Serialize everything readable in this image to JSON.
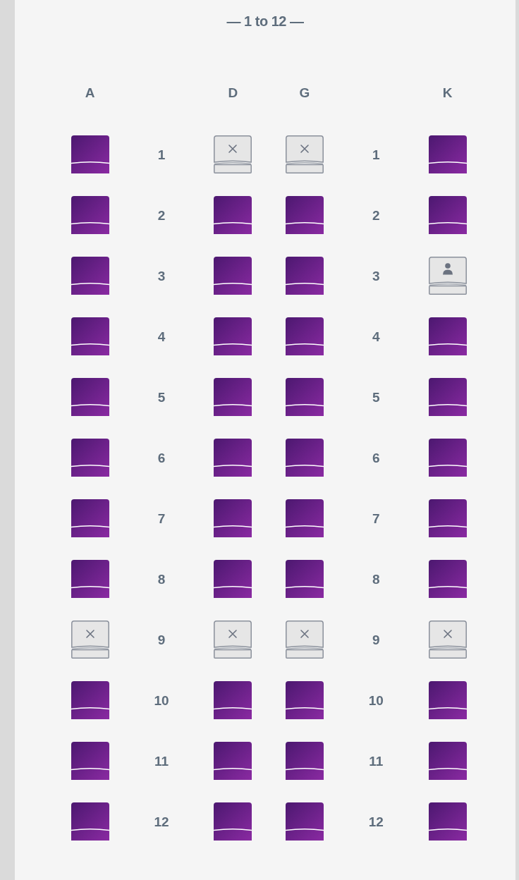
{
  "title": "— 1 to 12 —",
  "columns": [
    {
      "kind": "seat",
      "label": "A"
    },
    {
      "kind": "aisle"
    },
    {
      "kind": "seat",
      "label": "D"
    },
    {
      "kind": "seat",
      "label": "G"
    },
    {
      "kind": "aisle"
    },
    {
      "kind": "seat",
      "label": "K"
    }
  ],
  "rows": [
    {
      "cells": [
        {
          "kind": "open_seat"
        },
        {
          "kind": "row_number",
          "text": "1"
        },
        {
          "kind": "blocked_seat"
        },
        {
          "kind": "blocked_seat"
        },
        {
          "kind": "row_number",
          "text": "1"
        },
        {
          "kind": "open_seat"
        }
      ]
    },
    {
      "cells": [
        {
          "kind": "open_seat"
        },
        {
          "kind": "row_number",
          "text": "2"
        },
        {
          "kind": "open_seat"
        },
        {
          "kind": "open_seat"
        },
        {
          "kind": "row_number",
          "text": "2"
        },
        {
          "kind": "open_seat"
        }
      ]
    },
    {
      "cells": [
        {
          "kind": "open_seat"
        },
        {
          "kind": "row_number",
          "text": "3"
        },
        {
          "kind": "open_seat"
        },
        {
          "kind": "open_seat"
        },
        {
          "kind": "row_number",
          "text": "3"
        },
        {
          "kind": "taken_seat"
        }
      ]
    },
    {
      "cells": [
        {
          "kind": "open_seat"
        },
        {
          "kind": "row_number",
          "text": "4"
        },
        {
          "kind": "open_seat"
        },
        {
          "kind": "open_seat"
        },
        {
          "kind": "row_number",
          "text": "4"
        },
        {
          "kind": "open_seat"
        }
      ]
    },
    {
      "cells": [
        {
          "kind": "open_seat"
        },
        {
          "kind": "row_number",
          "text": "5"
        },
        {
          "kind": "open_seat"
        },
        {
          "kind": "open_seat"
        },
        {
          "kind": "row_number",
          "text": "5"
        },
        {
          "kind": "open_seat"
        }
      ]
    },
    {
      "cells": [
        {
          "kind": "open_seat"
        },
        {
          "kind": "row_number",
          "text": "6"
        },
        {
          "kind": "open_seat"
        },
        {
          "kind": "open_seat"
        },
        {
          "kind": "row_number",
          "text": "6"
        },
        {
          "kind": "open_seat"
        }
      ]
    },
    {
      "cells": [
        {
          "kind": "open_seat"
        },
        {
          "kind": "row_number",
          "text": "7"
        },
        {
          "kind": "open_seat"
        },
        {
          "kind": "open_seat"
        },
        {
          "kind": "row_number",
          "text": "7"
        },
        {
          "kind": "open_seat"
        }
      ]
    },
    {
      "cells": [
        {
          "kind": "open_seat"
        },
        {
          "kind": "row_number",
          "text": "8"
        },
        {
          "kind": "open_seat"
        },
        {
          "kind": "open_seat"
        },
        {
          "kind": "row_number",
          "text": "8"
        },
        {
          "kind": "open_seat"
        }
      ]
    },
    {
      "cells": [
        {
          "kind": "blocked_seat"
        },
        {
          "kind": "row_number",
          "text": "9"
        },
        {
          "kind": "blocked_seat"
        },
        {
          "kind": "blocked_seat"
        },
        {
          "kind": "row_number",
          "text": "9"
        },
        {
          "kind": "blocked_seat"
        }
      ]
    },
    {
      "cells": [
        {
          "kind": "open_seat"
        },
        {
          "kind": "row_number",
          "text": "10"
        },
        {
          "kind": "open_seat"
        },
        {
          "kind": "open_seat"
        },
        {
          "kind": "row_number",
          "text": "10"
        },
        {
          "kind": "open_seat"
        }
      ]
    },
    {
      "cells": [
        {
          "kind": "open_seat"
        },
        {
          "kind": "row_number",
          "text": "11"
        },
        {
          "kind": "open_seat"
        },
        {
          "kind": "open_seat"
        },
        {
          "kind": "row_number",
          "text": "11"
        },
        {
          "kind": "open_seat"
        }
      ]
    },
    {
      "cells": [
        {
          "kind": "open_seat"
        },
        {
          "kind": "row_number",
          "text": "12"
        },
        {
          "kind": "open_seat"
        },
        {
          "kind": "open_seat"
        },
        {
          "kind": "row_number",
          "text": "12"
        },
        {
          "kind": "open_seat"
        }
      ]
    }
  ]
}
